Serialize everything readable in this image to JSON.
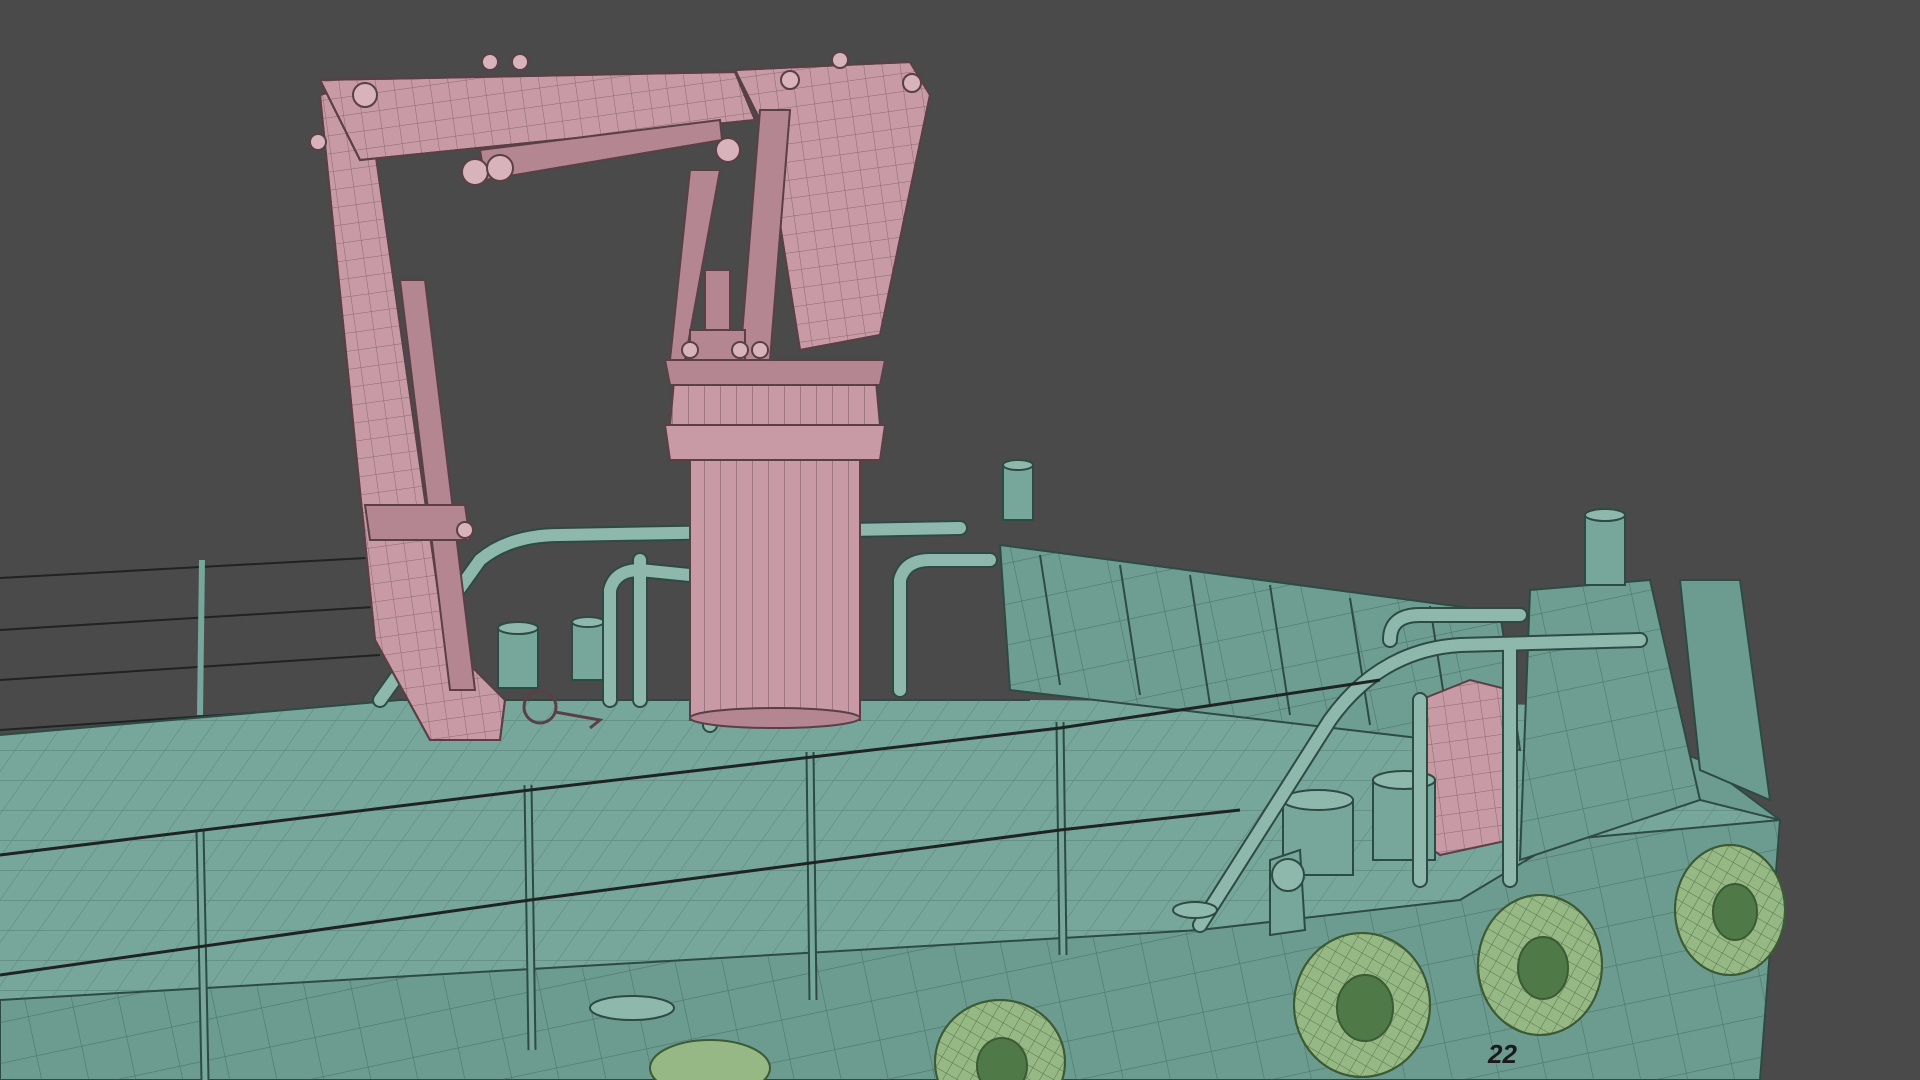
{
  "scene": {
    "background_color": "#4a4a4a",
    "crane_color": "#c79aa5",
    "deck_color": "#76a79a",
    "fender_color": "#95b884",
    "wire_color": "#2a2f2e"
  },
  "labels": {
    "hull_number": "22"
  }
}
